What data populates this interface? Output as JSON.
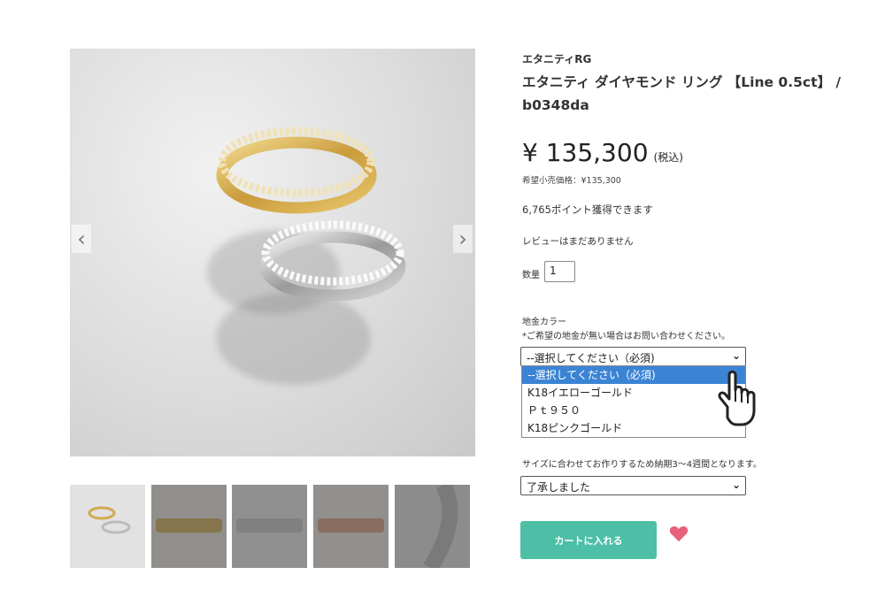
{
  "product": {
    "brand": "エタニティRG",
    "title": "エタニティ ダイヤモンド リング 【Line 0.5ct】 / b0348da",
    "price": "¥ 135,300",
    "tax_label": "(税込)",
    "msrp": "希望小売価格：¥135,300",
    "points": "6,765ポイント獲得できます",
    "reviews": "レビューはまだありません"
  },
  "quantity": {
    "label": "数量",
    "value": "1"
  },
  "metal_color": {
    "label": "地金カラー",
    "note": "*ご希望の地金が無い場合はお問い合わせください。",
    "selected": "--選択してください（必須)",
    "options": [
      "--選択してください（必須)",
      "K18イエローゴールド",
      "Ｐｔ９５０",
      "K18ピンクゴールド"
    ]
  },
  "size_agreement": {
    "note": "サイズに合わせてお作りするため納期3〜4週間となります。",
    "selected": "了承しました"
  },
  "actions": {
    "cart": "カートに入れる"
  },
  "gallery": {
    "prev": "‹",
    "next": "›",
    "thumbnails": [
      "thumb-1",
      "thumb-2",
      "thumb-3",
      "thumb-4",
      "thumb-5"
    ]
  },
  "colors": {
    "cart_button": "#4dbfa6",
    "heart": "#e8617a",
    "dropdown_selected": "#3b84d4"
  },
  "icons": {
    "favorite": "heart-icon",
    "chevron": "chevron-down-icon",
    "pointer": "hand-cursor-icon"
  }
}
